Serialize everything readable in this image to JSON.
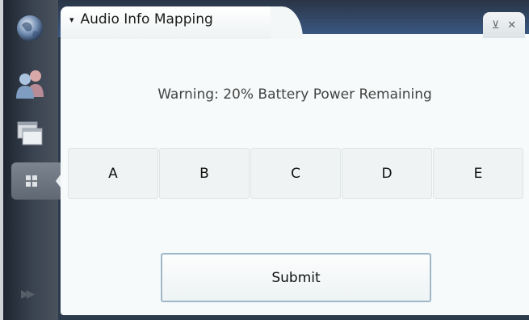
{
  "window": {
    "title": "Audio Info Mapping",
    "title_arrow": "▾",
    "minimize_glyph": "⊻",
    "close_glyph": "✕"
  },
  "sidebar": {
    "items": [
      {
        "icon": "globe-icon"
      },
      {
        "icon": "users-icon"
      },
      {
        "icon": "windows-icon"
      },
      {
        "icon": "applications-grid-icon",
        "active": true
      }
    ],
    "bottom_glyph": "▶▶"
  },
  "main": {
    "warning": "Warning: 20% Battery Power Remaining",
    "options": [
      "A",
      "B",
      "C",
      "D",
      "E"
    ],
    "submit_label": "Submit"
  }
}
